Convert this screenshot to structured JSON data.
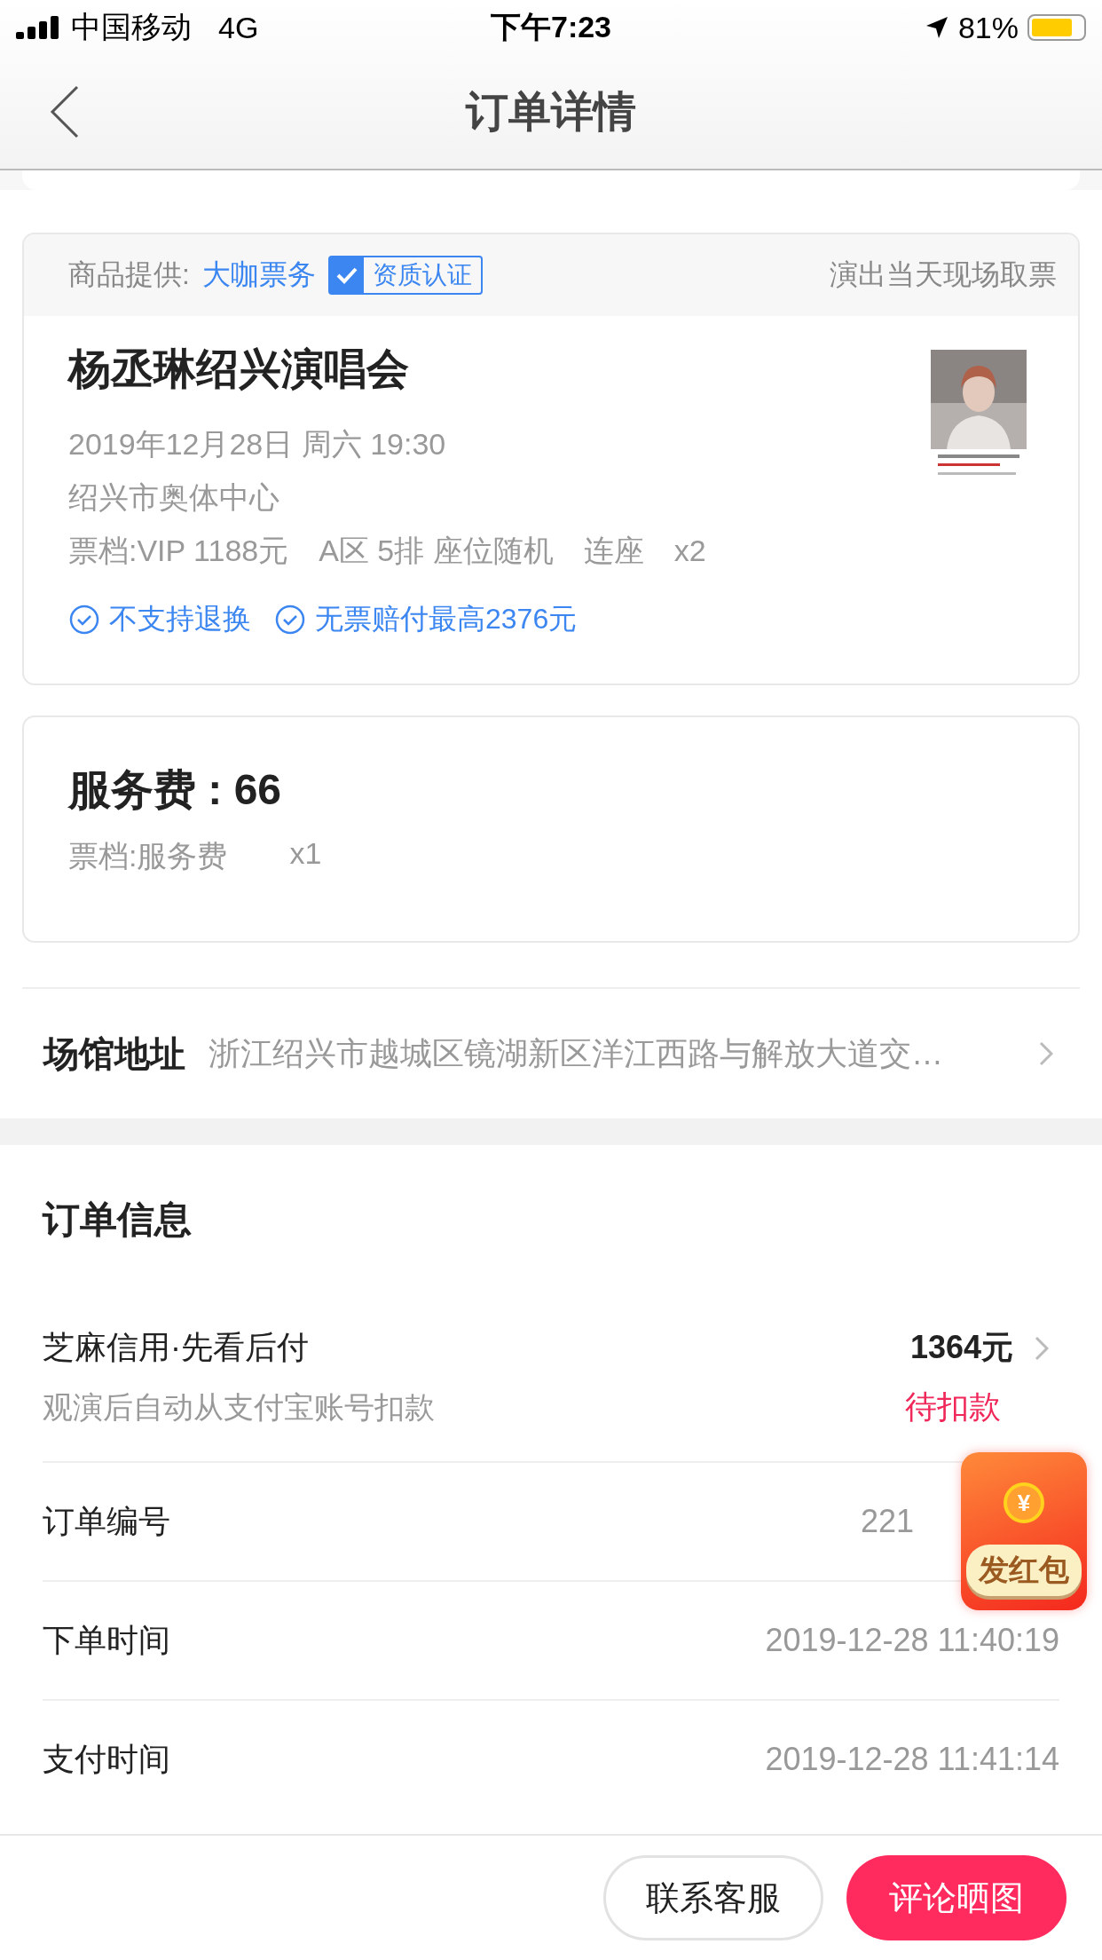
{
  "status_bar": {
    "carrier": "中国移动",
    "network": "4G",
    "time": "下午7:23",
    "battery_percent": "81%"
  },
  "nav": {
    "title": "订单详情"
  },
  "ticket": {
    "provider_label": "商品提供:",
    "provider_name": "大咖票务",
    "badge": "资质认证",
    "pickup": "演出当天现场取票",
    "title": "杨丞琳绍兴演唱会",
    "lines": [
      "2019年12月28日 周六 19:30",
      "绍兴市奥体中心",
      "票档:VIP 1188元　A区 5排 座位随机　连座　x2"
    ],
    "guarantees": [
      "不支持退换",
      "无票赔付最高2376元"
    ],
    "poster": {
      "kind": "picture"
    }
  },
  "service": {
    "title": "服务费 : 66",
    "tier": "票档:服务费",
    "qty": "x1"
  },
  "venue": {
    "label": "场馆地址",
    "address": "浙江绍兴市越城区镜湖新区洋江西路与解放大道交…"
  },
  "order": {
    "title": "订单信息",
    "payment": {
      "method": "芝麻信用·先看后付",
      "note": "观演后自动从支付宝账号扣款",
      "amount": "1364元",
      "status": "待扣款"
    },
    "rows": [
      {
        "label": "订单编号",
        "value": "221",
        "covered": true
      },
      {
        "label": "下单时间",
        "value": "2019-12-28 11:40:19"
      },
      {
        "label": "支付时间",
        "value": "2019-12-28 11:41:14"
      }
    ]
  },
  "red_packet": {
    "label": "发红包",
    "symbol": "¥"
  },
  "buttons": [
    {
      "label": "联系客服",
      "kind": "outline"
    },
    {
      "label": "评论晒图",
      "kind": "primary"
    }
  ]
}
